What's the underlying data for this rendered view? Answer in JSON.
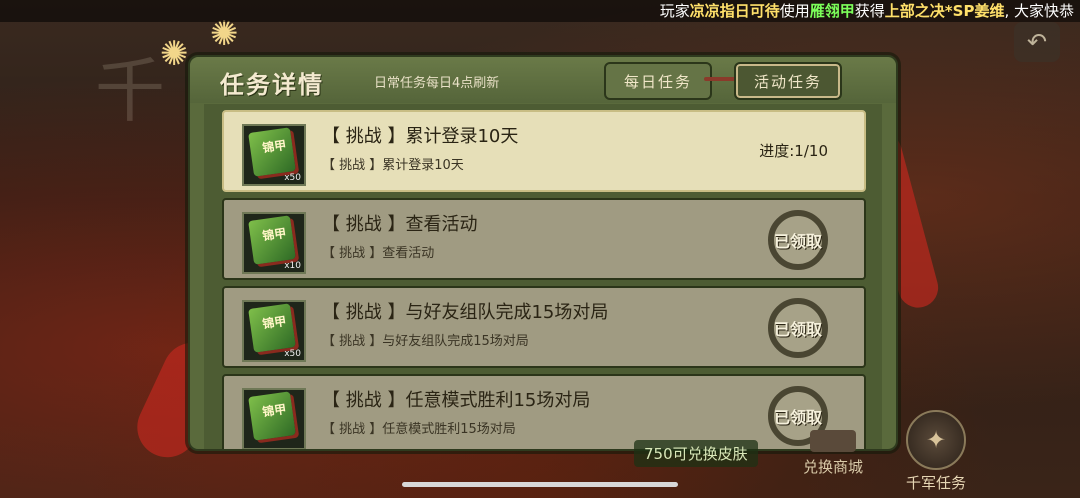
{
  "ticker": {
    "prefix": "玩家",
    "player": "凉凉指日可待",
    "mid1": "使用",
    "item": "雁翎甲",
    "mid2": "获得",
    "reward": "上部之决*SP姜维",
    "suffix": ", 大家快恭"
  },
  "background": {
    "calligraphy": "千"
  },
  "panel": {
    "title": "任务详情",
    "subtitle": "日常任务每日4点刷新",
    "tabs": [
      {
        "label": "每日任务",
        "active": false
      },
      {
        "label": "活动任务",
        "active": true
      }
    ]
  },
  "tasks": [
    {
      "title": "【 挑战 】累计登录10天",
      "sub": "【 挑战 】累计登录10天",
      "reward_label": "锦甲",
      "qty": "x50",
      "status": "进度:1/10"
    },
    {
      "title": "【 挑战 】查看活动",
      "sub": "【 挑战 】查看活动",
      "reward_label": "锦甲",
      "qty": "x10",
      "status": "已领取"
    },
    {
      "title": "【 挑战 】与好友组队完成15场对局",
      "sub": "【 挑战 】与好友组队完成15场对局",
      "reward_label": "锦甲",
      "qty": "x50",
      "status": "已领取"
    },
    {
      "title": "【 挑战 】任意模式胜利15场对局",
      "sub": "【 挑战 】任意模式胜利15场对局",
      "reward_label": "锦甲",
      "qty": "",
      "status": "已领取"
    }
  ],
  "footer": {
    "coins": "750可兑换皮肤",
    "shop_label": "兑换商城",
    "army_label": "千军任务"
  },
  "icons": {
    "back": "back-arrow-icon",
    "scroll": "scroll-icon",
    "army": "army-icon",
    "shop": "shop-icon"
  }
}
